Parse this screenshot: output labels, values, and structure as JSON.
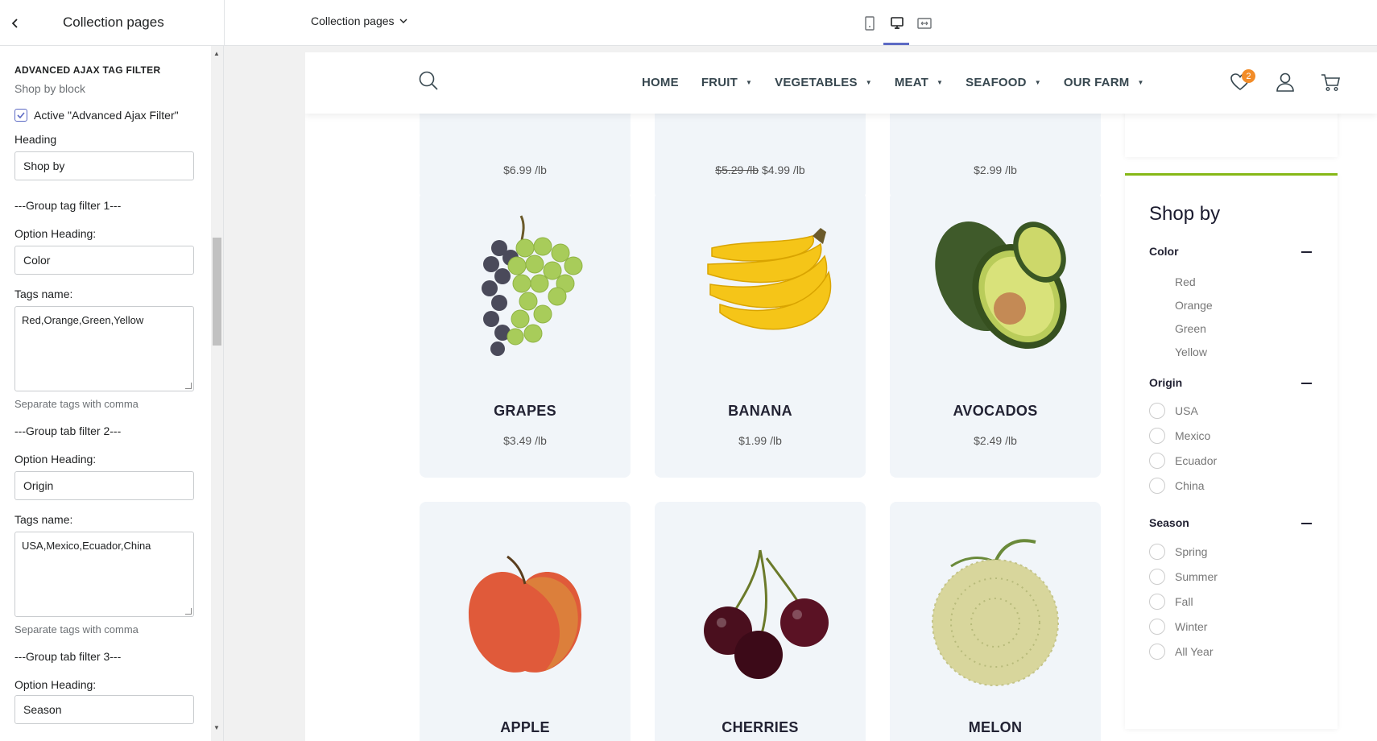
{
  "topbar": {
    "panel_title": "Collection pages",
    "page_select": "Collection pages"
  },
  "sidebar": {
    "section_title": "ADVANCED AJAX TAG FILTER",
    "section_sub": "Shop by block",
    "active_label": "Active \"Advanced Ajax Filter\"",
    "heading_label": "Heading",
    "heading_value": "Shop by",
    "group1": "---Group tag filter 1---",
    "opt_heading_label": "Option Heading:",
    "group1_heading": "Color",
    "tags_label": "Tags name:",
    "group1_tags": "Red,Orange,Green,Yellow",
    "help": "Separate tags with comma",
    "group2": "---Group tab filter 2---",
    "group2_heading": "Origin",
    "group2_tags": "USA,Mexico,Ecuador,China",
    "group3": "---Group tab filter 3---",
    "group3_heading": "Season"
  },
  "nav": {
    "items": [
      {
        "label": "HOME",
        "dropdown": false
      },
      {
        "label": "FRUIT",
        "dropdown": true
      },
      {
        "label": "VEGETABLES",
        "dropdown": true
      },
      {
        "label": "MEAT",
        "dropdown": true
      },
      {
        "label": "SEAFOOD",
        "dropdown": true
      },
      {
        "label": "OUR FARM",
        "dropdown": true
      }
    ],
    "wishlist_count": "2"
  },
  "products": {
    "row0": [
      {
        "old_price": "",
        "price": "$6.99 /lb"
      },
      {
        "old_price": "$5.29 /lb",
        "price": "$4.99 /lb"
      },
      {
        "old_price": "",
        "price": "$2.99 /lb"
      }
    ],
    "row1": [
      {
        "name": "GRAPES",
        "price": "$3.49 /lb"
      },
      {
        "name": "BANANA",
        "price": "$1.99 /lb"
      },
      {
        "name": "AVOCADOS",
        "price": "$2.49 /lb"
      }
    ],
    "row2": [
      {
        "name": "APPLE"
      },
      {
        "name": "CHERRIES"
      },
      {
        "name": "MELON"
      }
    ]
  },
  "filter": {
    "title": "Shop by",
    "color": {
      "heading": "Color",
      "options": [
        "Red",
        "Orange",
        "Green",
        "Yellow"
      ]
    },
    "origin": {
      "heading": "Origin",
      "options": [
        "USA",
        "Mexico",
        "Ecuador",
        "China"
      ]
    },
    "season": {
      "heading": "Season",
      "options": [
        "Spring",
        "Summer",
        "Fall",
        "Winter",
        "All Year"
      ]
    }
  },
  "colors": {
    "accent": "#86b817",
    "badge": "#f28c28",
    "card_bg": "#f1f5f9",
    "editor_accent": "#5c6ac4"
  }
}
